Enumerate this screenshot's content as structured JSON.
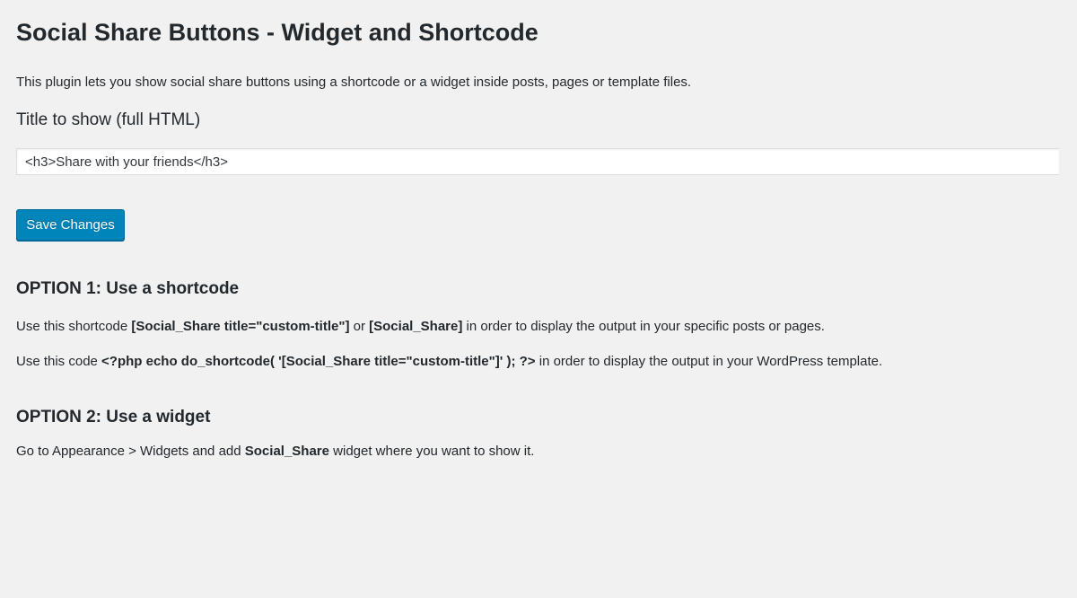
{
  "page": {
    "title": "Social Share Buttons - Widget and Shortcode",
    "description": "This plugin lets you show social share buttons using a shortcode or a widget inside posts, pages or template files."
  },
  "form": {
    "title_label": "Title to show (full HTML)",
    "title_value": "<h3>Share with your friends</h3>",
    "save_label": "Save Changes"
  },
  "option1": {
    "heading": "OPTION 1: Use a shortcode",
    "line1": {
      "pre": "Use this shortcode ",
      "code1": "[Social_Share title=\"custom-title\"]",
      "mid": " or ",
      "code2": "[Social_Share]",
      "post": " in order to display the output in your specific posts or pages."
    },
    "line2": {
      "pre": "Use this code ",
      "code": "<?php echo do_shortcode( '[Social_Share title=\"custom-title\"]' ); ?>",
      "post": " in order to display the output in your WordPress template."
    }
  },
  "option2": {
    "heading": "OPTION 2: Use a widget",
    "line": {
      "pre": "Go to Appearance > Widgets and add ",
      "code": "Social_Share",
      "post": " widget where you want to show it."
    }
  },
  "colors": {
    "background": "#f1f1f1",
    "text": "#23282d",
    "primary_button": "#0085ba",
    "primary_button_border": "#006799"
  }
}
